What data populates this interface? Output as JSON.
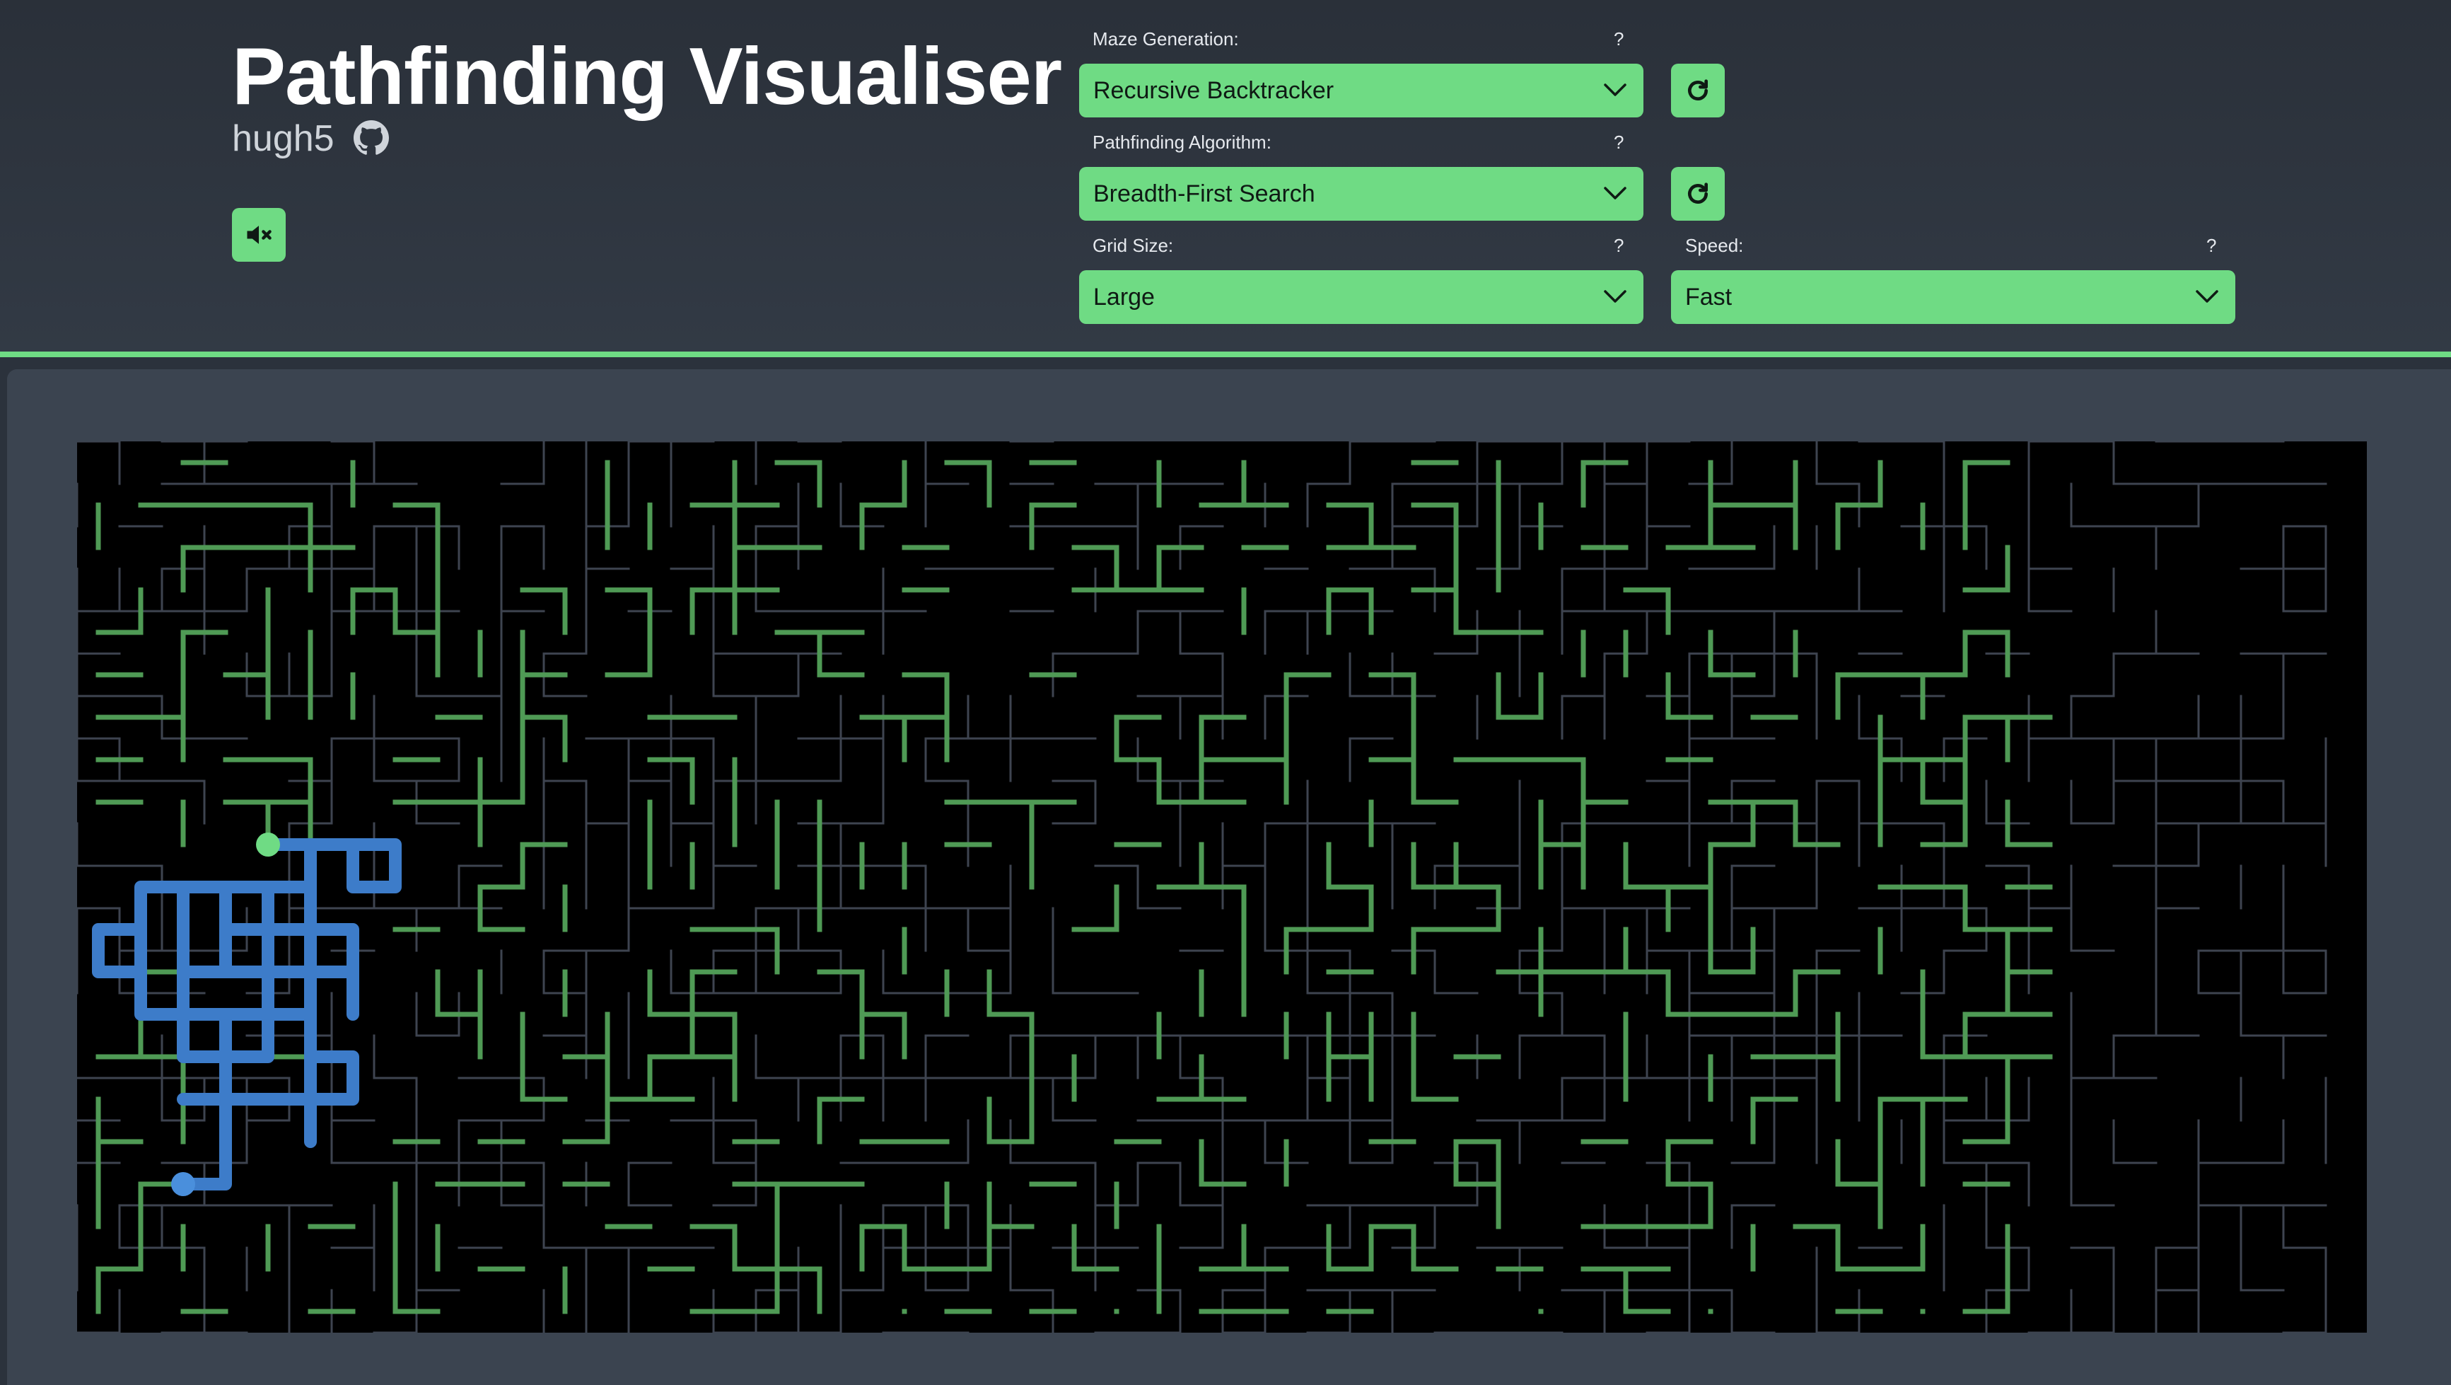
{
  "header": {
    "title": "Pathfinding Visualiser",
    "author": "hugh5"
  },
  "icons": {
    "github": "github-icon",
    "mute": "speaker-muted-icon",
    "refresh": "refresh-icon",
    "chevron": "chevron-down-icon"
  },
  "controls": {
    "maze_generation": {
      "label": "Maze Generation:",
      "help": "?",
      "value": "Recursive Backtracker"
    },
    "pathfinding_algorithm": {
      "label": "Pathfinding Algorithm:",
      "help": "?",
      "value": "Breadth-First Search"
    },
    "grid_size": {
      "label": "Grid Size:",
      "help": "?",
      "value": "Large"
    },
    "speed": {
      "label": "Speed:",
      "help": "?",
      "value": "Fast"
    }
  },
  "colors": {
    "accent": "#6fdb84",
    "background": "#2b323c",
    "board": "#3b4450",
    "maze_bg": "#000000",
    "visited_path": "#4f9a55",
    "shortest_path": "#3d7cc9",
    "wall": "#3e4450",
    "start_node": "#6fdb84",
    "end_node": "#4a8fdc"
  }
}
